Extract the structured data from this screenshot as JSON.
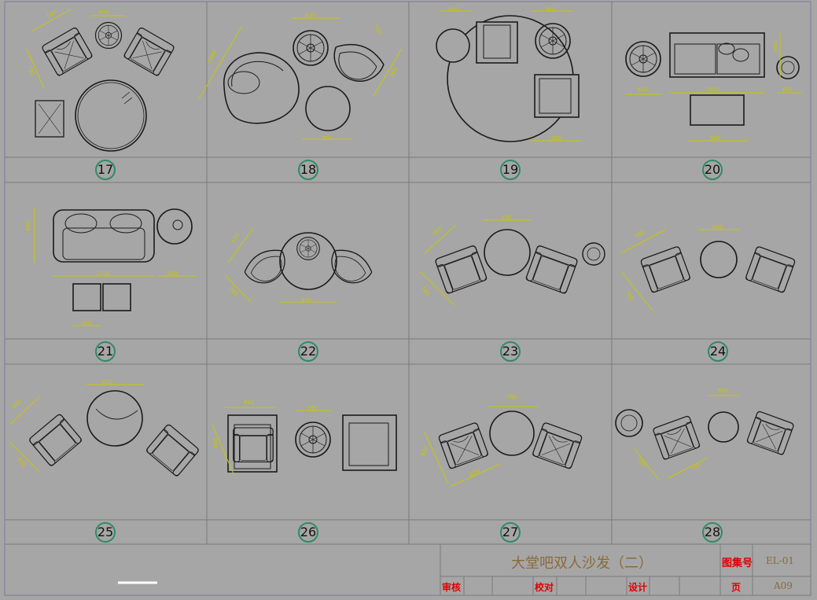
{
  "sheet": {
    "title": "大堂吧双人沙发（二）",
    "drawing_set_label": "图集号",
    "drawing_set_value": "EL-01",
    "review_label": "审核",
    "check_label": "校对",
    "design_label": "设计",
    "page_label": "页",
    "page_value": "A09"
  },
  "colors": {
    "background": "#a6a6a6",
    "line": "#1a1a1a",
    "dimension": "#c8c800",
    "number_ring": "#2e8b67",
    "title_red": "#e00000",
    "title_brown": "#8a6a3a"
  },
  "groups": [
    {
      "number": "17",
      "dims": [
        "500",
        "450",
        "780"
      ]
    },
    {
      "number": "18",
      "dims": [
        "630",
        "1080",
        "730",
        "780",
        "700"
      ]
    },
    {
      "number": "19",
      "dims": [
        "550",
        "660",
        "780"
      ]
    },
    {
      "number": "20",
      "dims": [
        "600",
        "1500",
        "900",
        "400",
        "900"
      ]
    },
    {
      "number": "21",
      "dims": [
        "880",
        "1700",
        "560",
        "450"
      ]
    },
    {
      "number": "22",
      "dims": [
        "610",
        "560",
        "900"
      ]
    },
    {
      "number": "23",
      "dims": [
        "700",
        "780",
        "740"
      ]
    },
    {
      "number": "24",
      "dims": [
        "780",
        "600",
        "760"
      ]
    },
    {
      "number": "25",
      "dims": [
        "900",
        "910",
        "850"
      ]
    },
    {
      "number": "26",
      "dims": [
        "840",
        "550",
        "860"
      ]
    },
    {
      "number": "27",
      "dims": [
        "780",
        "810",
        "810"
      ]
    },
    {
      "number": "28",
      "dims": [
        "500",
        "780",
        "780"
      ]
    }
  ]
}
